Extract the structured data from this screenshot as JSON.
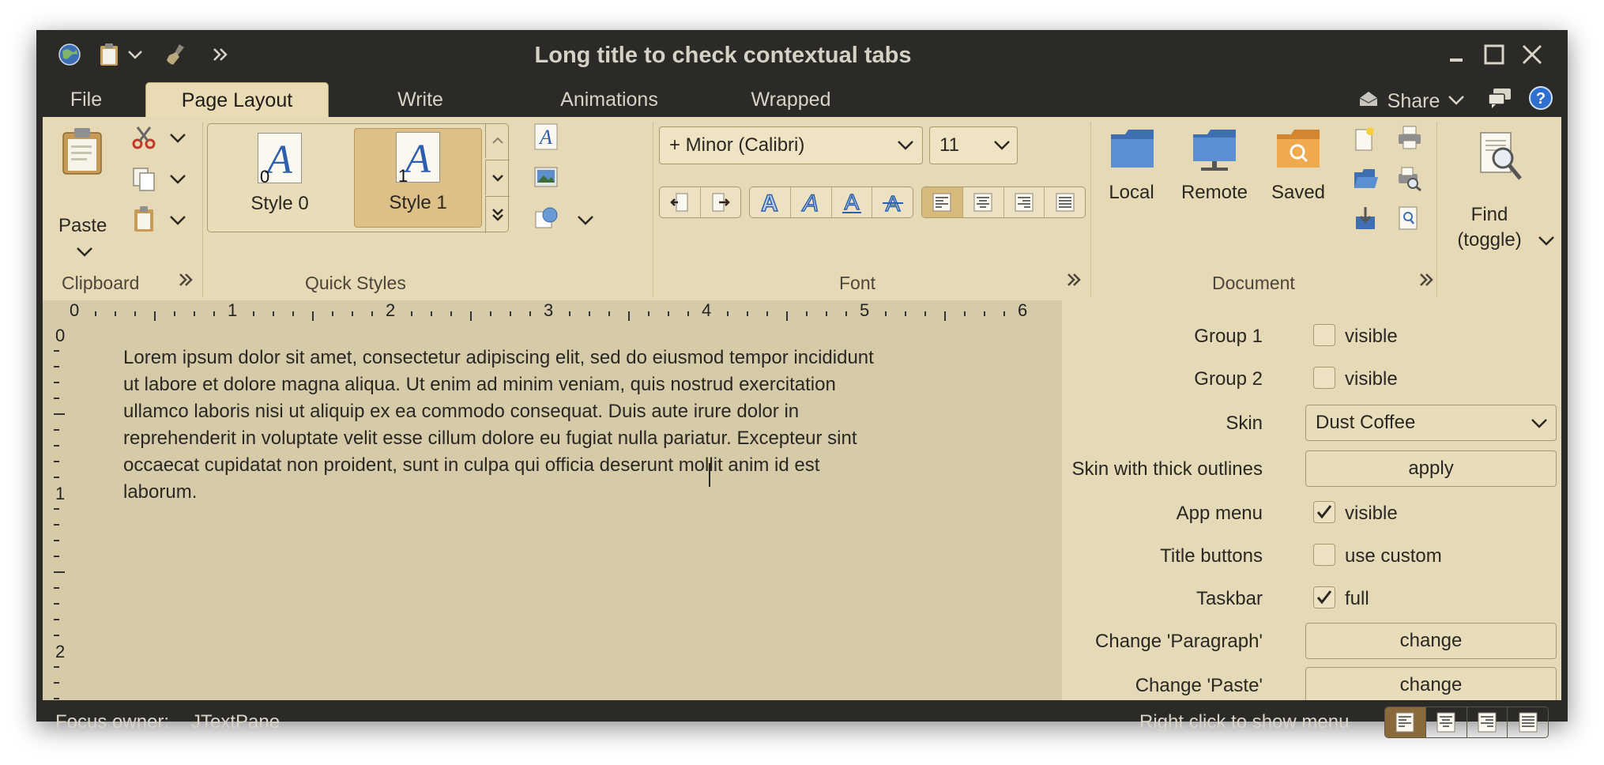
{
  "window": {
    "title": "Long title to check contextual tabs"
  },
  "tabs": [
    {
      "label": "File"
    },
    {
      "label": "Page Layout"
    },
    {
      "label": "Write"
    },
    {
      "label": "Animations"
    },
    {
      "label": "Wrapped"
    }
  ],
  "tabbar_right": {
    "share_label": "Share"
  },
  "ribbon": {
    "clipboard": {
      "label": "Clipboard",
      "paste_label": "Paste"
    },
    "quick_styles": {
      "label": "Quick Styles",
      "styles": [
        {
          "label": "Style 0",
          "index": "0"
        },
        {
          "label": "Style 1",
          "index": "1"
        }
      ]
    },
    "font": {
      "label": "Font",
      "font_name": "+ Minor (Calibri)",
      "font_size": "11"
    },
    "document": {
      "label": "Document",
      "buttons": [
        {
          "label": "Local"
        },
        {
          "label": "Remote"
        },
        {
          "label": "Saved"
        }
      ]
    },
    "find": {
      "line1": "Find",
      "line2": "(toggle)"
    }
  },
  "ruler": {
    "horizontal": [
      "0",
      "1",
      "2",
      "3",
      "4",
      "5",
      "6"
    ],
    "vertical": [
      "0",
      "1",
      "2"
    ]
  },
  "document": {
    "lines": [
      "Lorem ipsum dolor sit amet, consectetur adipiscing elit, sed do eiusmod tempor incididunt",
      "ut labore et dolore magna aliqua. Ut enim ad minim veniam, quis nostrud exercitation",
      "ullamco laboris nisi ut aliquip ex ea commodo consequat. Duis aute irure dolor in",
      "reprehenderit in voluptate velit esse cillum dolore eu fugiat nulla pariatur. Excepteur sint",
      "occaecat cupidatat non proident, sunt in culpa qui officia deserunt mollit anim id est",
      "laborum."
    ]
  },
  "panel": {
    "group1": {
      "label": "Group 1",
      "check_label": "visible",
      "checked": false
    },
    "group2": {
      "label": "Group 2",
      "check_label": "visible",
      "checked": false
    },
    "skin": {
      "label": "Skin",
      "value": "Dust Coffee"
    },
    "skin_thick": {
      "label": "Skin with thick outlines",
      "button": "apply"
    },
    "app_menu": {
      "label": "App menu",
      "check_label": "visible",
      "checked": true
    },
    "title_buttons": {
      "label": "Title buttons",
      "check_label": "use custom",
      "checked": false
    },
    "taskbar": {
      "label": "Taskbar",
      "check_label": "full",
      "checked": true
    },
    "change_paragraph": {
      "label": "Change 'Paragraph'",
      "button": "change"
    },
    "change_paste": {
      "label": "Change 'Paste'",
      "button": "change"
    }
  },
  "status": {
    "focus_label": "Focus owner:",
    "focus_value": "JTextPane",
    "hint": "Right click to show menu"
  },
  "colors": {
    "ribbon_bg": "#e6dab6",
    "frame": "#2b2a27",
    "selected": "#d8bb7c"
  }
}
